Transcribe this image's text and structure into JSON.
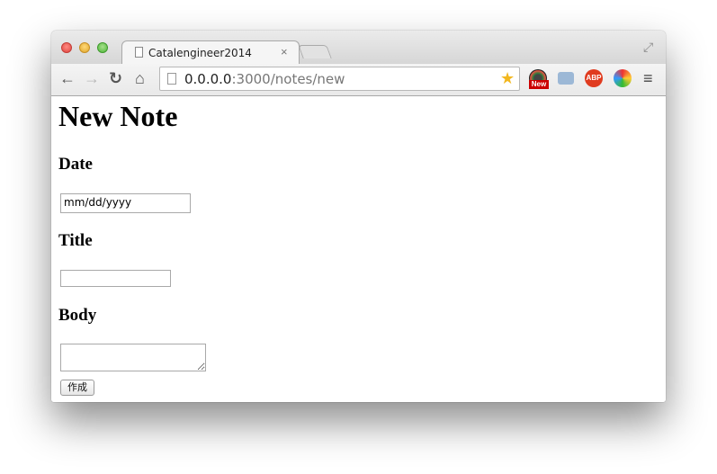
{
  "browser": {
    "tab_title": "Catalengineer2014",
    "tab_close_glyph": "×",
    "url_host": "0.0.0.0",
    "url_path": ":3000/notes/new",
    "extension_badge": "New",
    "abp_label": "ABP"
  },
  "page": {
    "title": "New Note",
    "date_label": "Date",
    "date_placeholder": "mm/dd/yyyy",
    "title_label": "Title",
    "title_value": "",
    "body_label": "Body",
    "body_value": "",
    "submit_label": "作成"
  },
  "icons": [
    "document-icon",
    "star-icon",
    "camera-icon",
    "menu-icon",
    "back-icon",
    "forward-icon",
    "reload-icon",
    "home-icon"
  ]
}
